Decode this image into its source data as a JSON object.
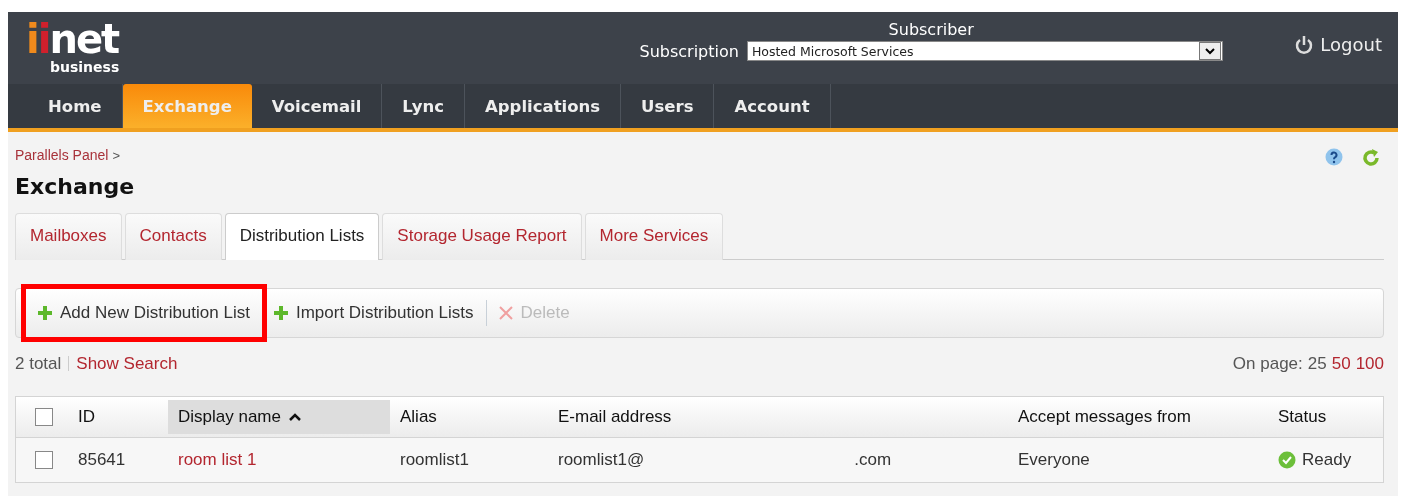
{
  "header": {
    "logo": {
      "mark_1": "i",
      "mark_2": "i",
      "name": "net",
      "tagline": "business"
    },
    "subscriber_label": "Subscriber",
    "subscription_label": "Subscription",
    "subscription_value": "Hosted Microsoft Services",
    "logout": "Logout"
  },
  "nav": [
    {
      "label": "Home",
      "selected": false
    },
    {
      "label": "Exchange",
      "selected": true
    },
    {
      "label": "Voicemail",
      "selected": false
    },
    {
      "label": "Lync",
      "selected": false
    },
    {
      "label": "Applications",
      "selected": false
    },
    {
      "label": "Users",
      "selected": false
    },
    {
      "label": "Account",
      "selected": false
    }
  ],
  "breadcrumb": {
    "link": "Parallels Panel",
    "separator": ">"
  },
  "page_title": "Exchange",
  "tabs": [
    {
      "label": "Mailboxes",
      "selected": false
    },
    {
      "label": "Contacts",
      "selected": false
    },
    {
      "label": "Distribution Lists",
      "selected": true
    },
    {
      "label": "Storage Usage Report",
      "selected": false
    },
    {
      "label": "More Services",
      "selected": false
    }
  ],
  "toolbar": [
    {
      "label": "Add New Distribution List",
      "kind": "add",
      "disabled": false,
      "highlighted": true
    },
    {
      "label": "Import Distribution Lists",
      "kind": "add",
      "disabled": false,
      "highlighted": false
    },
    {
      "label": "Delete",
      "kind": "delete",
      "disabled": true,
      "highlighted": false
    }
  ],
  "summary": {
    "total": "2 total",
    "search_link": "Show Search"
  },
  "paging": {
    "label": "On page:",
    "options": [
      {
        "label": "25",
        "selected": true
      },
      {
        "label": "50",
        "selected": false
      },
      {
        "label": "100",
        "selected": false
      }
    ]
  },
  "table": {
    "select_all_checked": false,
    "columns": [
      {
        "label": "ID",
        "sorted": false
      },
      {
        "label": "Display name",
        "sorted": true
      },
      {
        "label": "Alias",
        "sorted": false
      },
      {
        "label": "E-mail address",
        "sorted": false
      },
      {
        "label": "Accept messages from",
        "sorted": false
      },
      {
        "label": "Status",
        "sorted": false
      }
    ],
    "rows": [
      {
        "checked": false,
        "id": "85641",
        "display_name": "room list 1",
        "alias": "roomlist1",
        "email_start": "roomlist1@",
        "email_end": ".com",
        "accept_from": "Everyone",
        "status": {
          "label": "Ready",
          "kind": "ok"
        }
      }
    ]
  }
}
